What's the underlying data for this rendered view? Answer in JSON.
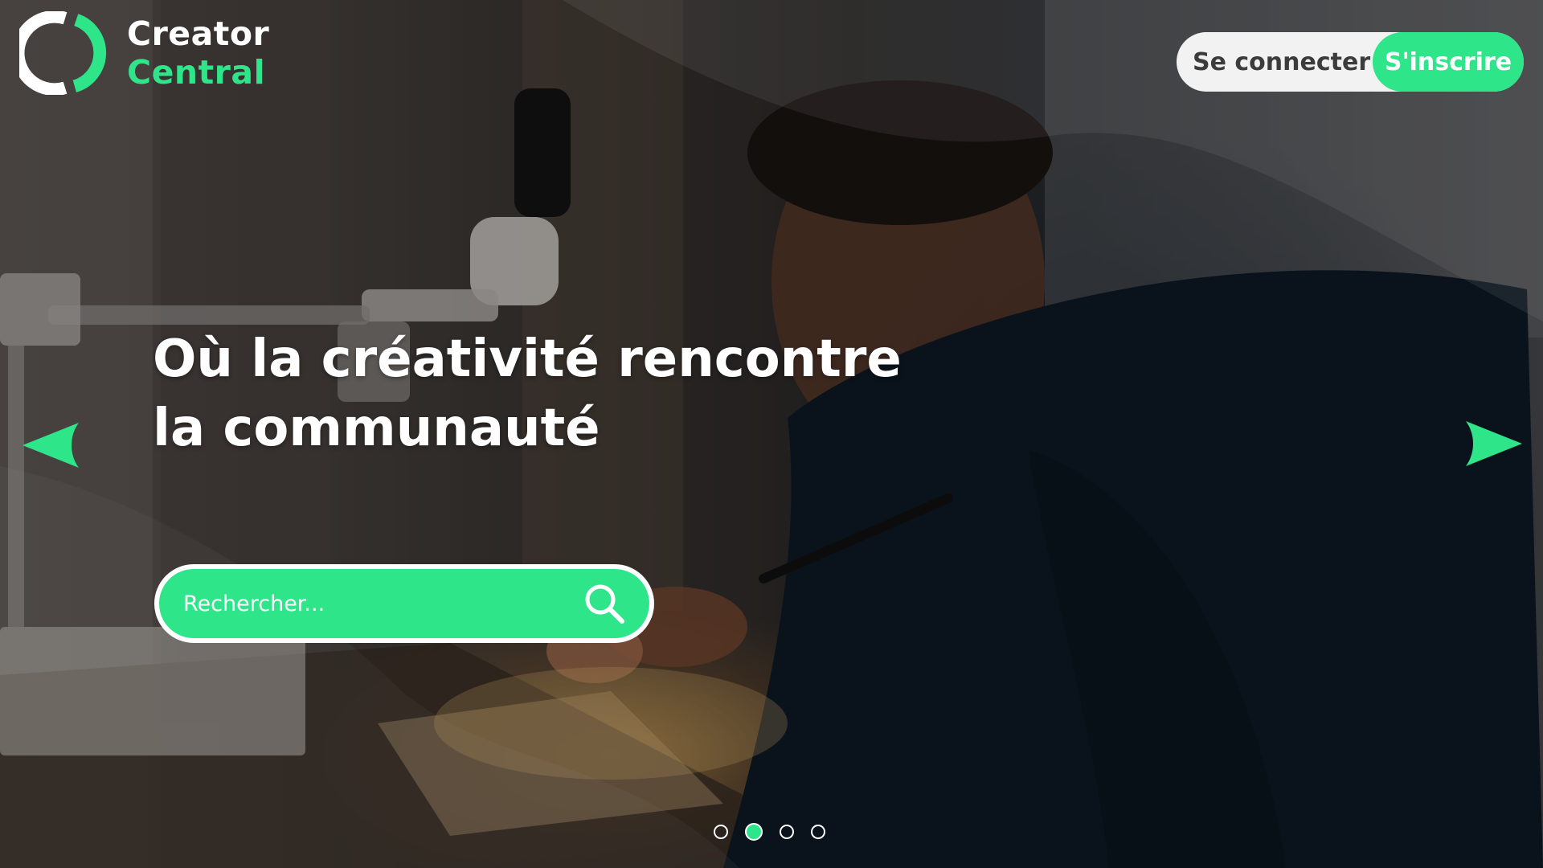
{
  "brand": {
    "name_line1": "Creator",
    "name_line2": "Central",
    "accent_color": "#2fe58a"
  },
  "auth": {
    "login_label": "Se connecter",
    "signup_label": "S'inscrire"
  },
  "hero": {
    "headline_line1": "Où la créativité rencontre",
    "headline_line2": "la communauté",
    "background_image": "person-working-at-electronics-workbench"
  },
  "search": {
    "placeholder": "Rechercher...",
    "icon": "search-icon"
  },
  "carousel": {
    "prev_icon": "arrow-left-icon",
    "next_icon": "arrow-right-icon",
    "slide_count": 4,
    "active_index": 1
  }
}
